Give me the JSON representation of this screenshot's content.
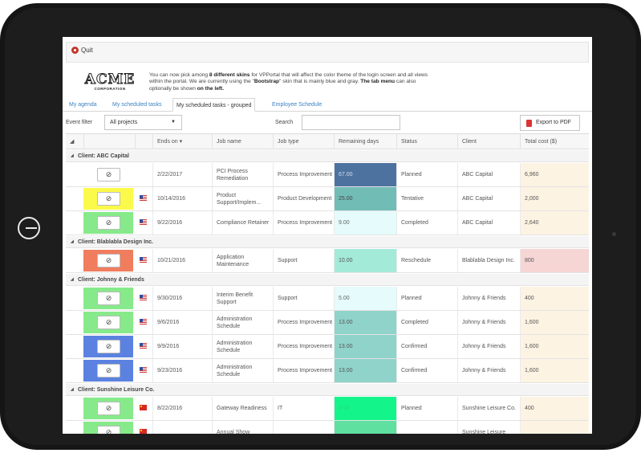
{
  "toolbar": {
    "quit_label": "Quit"
  },
  "logo": {
    "name": "ACME",
    "sub": "CORPORATION"
  },
  "info": {
    "t1": "You can now pick among ",
    "b1": "8 different skins",
    "t2": " for VPPortal that will affect the color theme of the login screen and all views within the portal. We are currently using the \"",
    "b2": "Bootstrap",
    "t3": "\" skin that is mainly blue and gray. ",
    "b3": "The tab menu",
    "t4": " can also optionally be shown ",
    "b4": "on the left."
  },
  "tabs": [
    {
      "label": "My agenda"
    },
    {
      "label": "My scheduled tasks"
    },
    {
      "label": "My scheduled tasks - grouped"
    },
    {
      "label": "Employee Schedule"
    }
  ],
  "filter": {
    "label": "Event filter",
    "value": "All projects"
  },
  "search": {
    "label": "Search"
  },
  "export": {
    "label": "Export to PDF"
  },
  "columns": [
    "Ends on ▾",
    "Job name",
    "Job type",
    "Remaining days",
    "Status",
    "Client",
    "Total cost ($)"
  ],
  "cancel_symbol": "⊘",
  "groups": [
    {
      "label": "Client: ABC Capital"
    },
    {
      "label": "Client: Blablabla Design Inc."
    },
    {
      "label": "Client: Johnny & Friends"
    },
    {
      "label": "Client: Sunshine Leisure Co."
    }
  ],
  "rows": [
    {
      "ends": "2/22/2017",
      "job": "PCI Process Remediation",
      "type": "Process Improvement",
      "days": "67.00",
      "status": "Planned",
      "client": "ABC Capital",
      "cost": "6,960",
      "color": "#ffffff",
      "days_color": "#4d72a0",
      "days_text": "#d6deea",
      "cost_color": "#fdf3e3",
      "flag": "none"
    },
    {
      "ends": "10/14/2016",
      "job": "Product Support/Implem...",
      "type": "Product Development",
      "days": "25.00",
      "status": "Tentative",
      "client": "ABC Capital",
      "cost": "2,000",
      "color": "#fbf94a",
      "days_color": "#72bcb6",
      "days_text": "#444444",
      "cost_color": "#fdf3e3",
      "flag": "us"
    },
    {
      "ends": "9/22/2016",
      "job": "Compliance Retainer",
      "type": "Process Improvement",
      "days": "9.00",
      "status": "Completed",
      "client": "ABC Capital",
      "cost": "2,640",
      "color": "#86ea8a",
      "days_color": "#e6fbfb",
      "days_text": "#666666",
      "cost_color": "#fdf3e3",
      "flag": "us"
    },
    {
      "ends": "10/21/2016",
      "job": "Application Maintenance",
      "type": "Support",
      "days": "10.00",
      "status": "Reschedule",
      "client": "Blablabla Design Inc.",
      "cost": "800",
      "color": "#f07d5e",
      "days_color": "#a3ead9",
      "days_text": "#555555",
      "cost_color": "#f6d5d5",
      "flag": "us"
    },
    {
      "ends": "9/30/2016",
      "job": "Interim Benefit Support",
      "type": "Support",
      "days": "5.00",
      "status": "Planned",
      "client": "Johnny & Friends",
      "cost": "400",
      "color": "#86ea8a",
      "days_color": "#e6fbfb",
      "days_text": "#666666",
      "cost_color": "#fdf3e3",
      "flag": "us"
    },
    {
      "ends": "9/6/2016",
      "job": "Administration Schedule",
      "type": "Process Improvement",
      "days": "13.00",
      "status": "Completed",
      "client": "Johnny & Friends",
      "cost": "1,600",
      "color": "#86ea8a",
      "days_color": "#8fd3ca",
      "days_text": "#555555",
      "cost_color": "#fdf3e3",
      "flag": "us"
    },
    {
      "ends": "9/9/2016",
      "job": "Administration Schedule",
      "type": "Process Improvement",
      "days": "13.00",
      "status": "Confirmed",
      "client": "Johnny & Friends",
      "cost": "1,600",
      "color": "#5b82e0",
      "days_color": "#8fd3ca",
      "days_text": "#555555",
      "cost_color": "#fdf3e3",
      "flag": "us"
    },
    {
      "ends": "9/23/2016",
      "job": "Administration Schedule",
      "type": "Process Improvement",
      "days": "13.00",
      "status": "Confirmed",
      "client": "Johnny & Friends",
      "cost": "1,600",
      "color": "#5b82e0",
      "days_color": "#8fd3ca",
      "days_text": "#555555",
      "cost_color": "#fdf3e3",
      "flag": "us"
    },
    {
      "ends": "8/22/2016",
      "job": "Gateway Readiness",
      "type": "IT",
      "days": "0.00",
      "status": "Planned",
      "client": "Sunshine Leisure Co.",
      "cost": "400",
      "color": "#86ea8a",
      "days_color": "#13f58a",
      "days_text": "#2fd37a",
      "cost_color": "#fdf3e3",
      "flag": "cn"
    },
    {
      "ends": "",
      "job": "Annual Show",
      "type": "",
      "days": "",
      "status": "",
      "client": "Sunshine Leisure",
      "cost": "",
      "color": "#86ea8a",
      "days_color": "#5fe0a0",
      "days_text": "#444444",
      "cost_color": "#fdf3e3",
      "flag": "cn"
    }
  ]
}
